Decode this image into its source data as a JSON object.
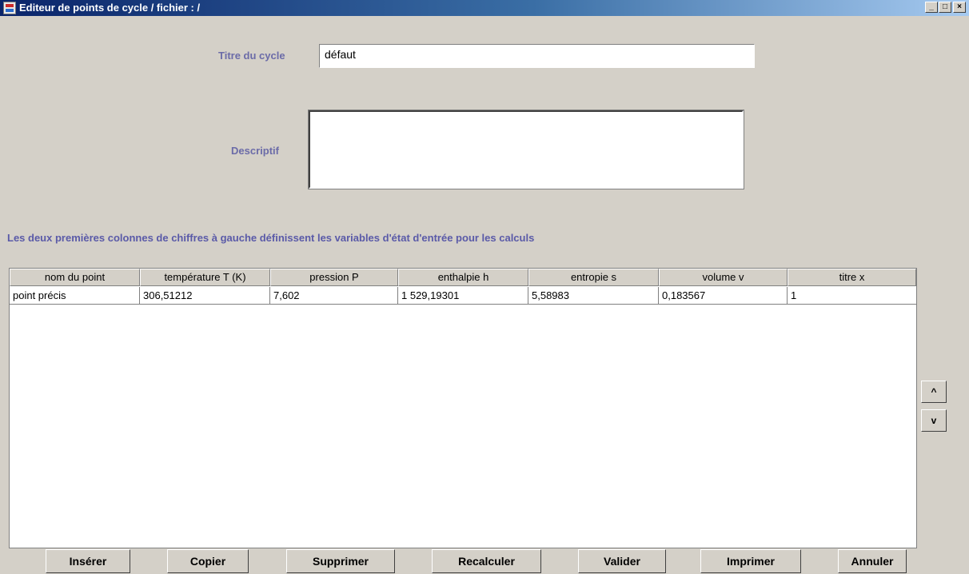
{
  "window": {
    "title": "Editeur de points de cycle / fichier : /",
    "controls": {
      "minimize": "_",
      "maximize": "□",
      "close": "×"
    },
    "icon": "app-icon"
  },
  "form": {
    "title_label": "Titre du cycle",
    "title_value": "défaut",
    "description_label": "Descriptif",
    "description_value": ""
  },
  "info_text": "Les deux premières colonnes de chiffres à gauche définissent les variables d'état d'entrée pour les calculs",
  "table": {
    "columns": [
      "nom du point",
      "température T (K)",
      "pression P",
      "enthalpie h",
      "entropie s",
      "volume v",
      "titre x"
    ],
    "rows": [
      [
        "point précis",
        "306,51212",
        "7,602",
        "1 529,19301",
        "5,58983",
        "0,183567",
        "1"
      ]
    ]
  },
  "side_buttons": {
    "up": "^",
    "down": "v"
  },
  "buttons": {
    "insert": "Insérer",
    "copy": "Copier",
    "delete": "Supprimer",
    "recalc": "Recalculer",
    "validate": "Valider",
    "print": "Imprimer",
    "cancel": "Annuler"
  },
  "colors": {
    "titlebar_start": "#0a246a",
    "titlebar_end": "#a6caf0",
    "label_color": "#6b6ba8",
    "background": "#d4d0c8"
  }
}
